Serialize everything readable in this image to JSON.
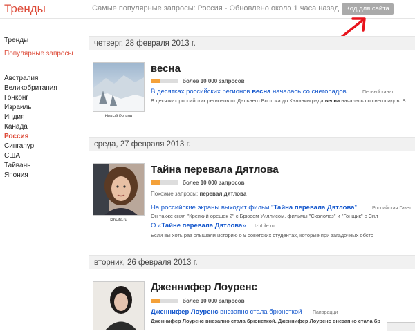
{
  "header": {
    "logo": "Тренды",
    "subtitle": "Самые популярные запросы: Россия - Обновлено около 1 часа назад",
    "embed_button": "Код для сайта"
  },
  "sidebar": {
    "nav": [
      {
        "label": "Тренды"
      },
      {
        "label": "Популярные запросы"
      }
    ],
    "countries": [
      "Австралия",
      "Великобритания",
      "Гонконг",
      "Израиль",
      "Индия",
      "Канада",
      "Россия",
      "Сингапур",
      "США",
      "Тайвань",
      "Япония"
    ],
    "selected_country": "Россия"
  },
  "colors": {
    "accent": "#dd4b39",
    "link": "#1155cc",
    "bar_fill": "#f4a139"
  },
  "days": [
    {
      "date": "четверг, 28 февраля 2013 г.",
      "items": [
        {
          "title": "весна",
          "count": "более 10 000 запросов",
          "popularity": 0.35,
          "thumb_caption": "Новый Регион",
          "news": [
            {
              "pre": "В десятках российских регионов ",
              "bold": "весна",
              "post": " началась со снегопадов",
              "source": "Первый канал",
              "snippet_pre": "В десятках российских регионов от Дальнего Востока до Калининграда ",
              "snippet_bold": "весна",
              "snippet_post": " началась со снегопадов. В"
            }
          ]
        }
      ]
    },
    {
      "date": "среда, 27 февраля 2013 г.",
      "items": [
        {
          "title": "Тайна перевала Дятлова",
          "count": "более 10 000 запросов",
          "popularity": 0.35,
          "related_label": "Похожие запросы:",
          "related_value": "перевал дятлова",
          "thumb_caption": "IzhLife.ru",
          "news": [
            {
              "pre": "На российские экраны выходит фильм \"",
              "bold": "Тайна перевала Дятлова",
              "post": "\"",
              "source": "Российская Газет",
              "snippet": "Он также снял \"Крепкий орешек 2\" с Брюсом Уиллисом, фильмы \"Скалолаз\" и \"Гонщик\" с Сил"
            },
            {
              "pre": "О «",
              "bold": "Тайне перевала Дятлова",
              "post": "»",
              "source": "IzhLife.ru",
              "snippet": "Если вы хоть раз слышали историю о 9 советских студентах, которые при загадочных обсто"
            }
          ]
        }
      ]
    },
    {
      "date": "вторник, 26 февраля 2013 г.",
      "items": [
        {
          "title": "Дженнифер Лоуренс",
          "count": "более 10 000 запросов",
          "popularity": 0.35,
          "news": [
            {
              "bold": "Дженнифер Лоуренс",
              "post": " внезапно стала брюнеткой",
              "source": "Папарацци",
              "snippet": "Дженнифер Лоуренс внезапно стала брюнеткой. Дженнифер Лоуренс внезапно стала бр"
            }
          ]
        }
      ]
    }
  ]
}
